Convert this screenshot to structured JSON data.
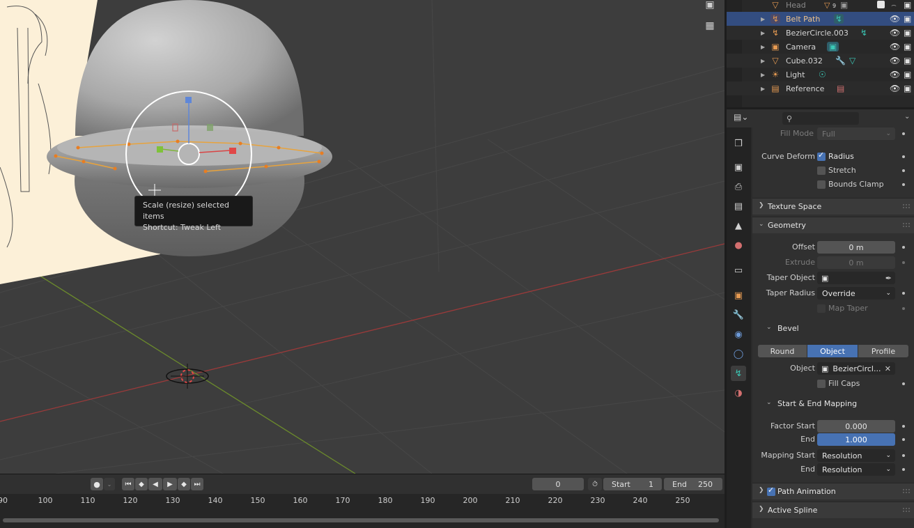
{
  "tooltip": {
    "line1": "Scale (resize) selected items",
    "line2": "Shortcut: Tweak Left"
  },
  "timeline": {
    "current_frame": "0",
    "start_label": "Start",
    "start_value": "1",
    "end_label": "End",
    "end_value": "250",
    "ticks": [
      "90",
      "100",
      "110",
      "120",
      "130",
      "140",
      "150",
      "160",
      "170",
      "180",
      "190",
      "200",
      "210",
      "220",
      "230",
      "240",
      "250"
    ]
  },
  "outliner": {
    "rows": [
      {
        "name": "Head",
        "icon": "mesh-icon",
        "data_badge": "9"
      },
      {
        "name": "Belt Path",
        "icon": "curve-icon",
        "selected": true
      },
      {
        "name": "BezierCircle.003",
        "icon": "curve-icon"
      },
      {
        "name": "Camera",
        "icon": "camera-icon"
      },
      {
        "name": "Cube.032",
        "icon": "mesh-icon"
      },
      {
        "name": "Light",
        "icon": "light-icon"
      },
      {
        "name": "Reference",
        "icon": "image-icon"
      }
    ]
  },
  "properties": {
    "search_placeholder": "",
    "fill_mode_label": "Fill Mode",
    "fill_mode_value": "Full",
    "curve_deform_label": "Curve Deform",
    "radius_label": "Radius",
    "stretch_label": "Stretch",
    "bounds_clamp_label": "Bounds Clamp",
    "texture_space_label": "Texture Space",
    "geometry_label": "Geometry",
    "offset_label": "Offset",
    "offset_value": "0 m",
    "extrude_label": "Extrude",
    "extrude_value": "0 m",
    "taper_object_label": "Taper Object",
    "taper_radius_label": "Taper Radius",
    "taper_radius_value": "Override",
    "map_taper_label": "Map Taper",
    "bevel_label": "Bevel",
    "bevel_modes": [
      "Round",
      "Object",
      "Profile"
    ],
    "bevel_object_label": "Object",
    "bevel_object_value": "BezierCircl...",
    "fill_caps_label": "Fill Caps",
    "mapping_label": "Start & End Mapping",
    "factor_start_label": "Factor Start",
    "factor_start_value": "0.000",
    "factor_end_label": "End",
    "factor_end_value": "1.000",
    "mapping_start_label": "Mapping Start",
    "mapping_start_value": "Resolution",
    "mapping_end_label": "End",
    "mapping_end_value": "Resolution",
    "path_animation_label": "Path Animation",
    "active_spline_label": "Active Spline"
  }
}
